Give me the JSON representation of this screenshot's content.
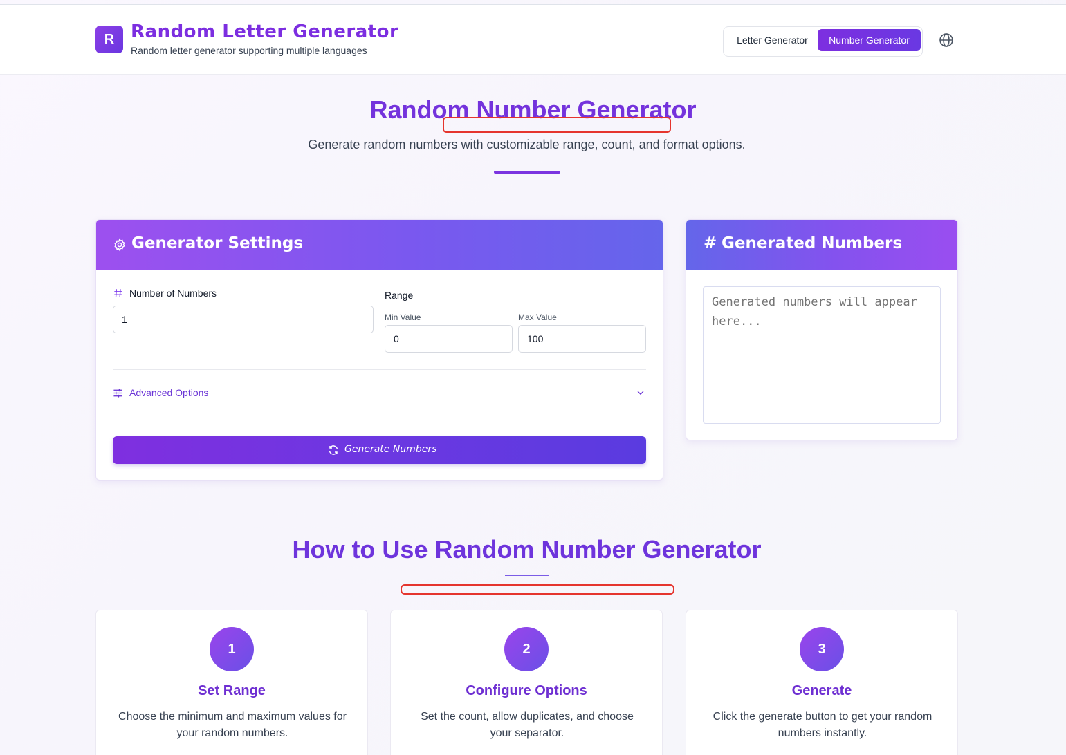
{
  "header": {
    "logo_letter": "R",
    "title": "Random Letter Generator",
    "subtitle": "Random letter generator supporting multiple languages",
    "nav": {
      "letter_label": "Letter Generator",
      "number_label": "Number Generator"
    },
    "language_icon": "globe-icon"
  },
  "hero": {
    "title": "Random Number Generator",
    "subtitle": "Generate random numbers with customizable range, count, and format options."
  },
  "settings": {
    "title": "Generator Settings",
    "title_icon": "gear-icon",
    "count_label": "Number of Numbers",
    "count_value": "1",
    "range_label": "Range",
    "min_label": "Min Value",
    "min_value": "0",
    "max_label": "Max Value",
    "max_value": "100",
    "advanced_label": "Advanced Options",
    "generate_label": "Generate Numbers"
  },
  "output": {
    "title": "Generated Numbers",
    "placeholder": "Generated numbers will appear here..."
  },
  "howto": {
    "title": "How to Use Random Number Generator",
    "steps": [
      {
        "num": "1",
        "title": "Set Range",
        "desc": "Choose the minimum and maximum values for your random numbers."
      },
      {
        "num": "2",
        "title": "Configure Options",
        "desc": "Set the count, allow duplicates, and choose your separator."
      },
      {
        "num": "3",
        "title": "Generate",
        "desc": "Click the generate button to get your random numbers instantly."
      }
    ]
  },
  "colors": {
    "brand": "#7c2ee0",
    "annotation": "#e5352e"
  }
}
